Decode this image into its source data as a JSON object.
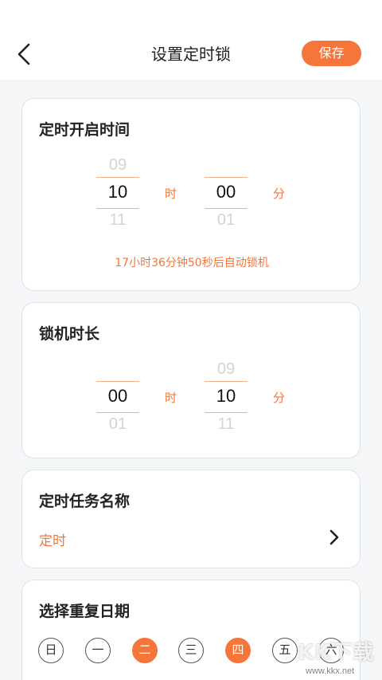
{
  "header": {
    "title": "设置定时锁",
    "save_label": "保存"
  },
  "start_time": {
    "title": "定时开启时间",
    "hour": {
      "prev": "09",
      "selected": "10",
      "next": "11"
    },
    "minute": {
      "prev": "",
      "selected": "00",
      "next": "01"
    },
    "hour_unit": "时",
    "minute_unit": "分",
    "hint": "17小时36分钟50秒后自动锁机"
  },
  "duration": {
    "title": "锁机时长",
    "hour": {
      "prev": "",
      "selected": "00",
      "next": "01"
    },
    "minute": {
      "prev": "09",
      "selected": "10",
      "next": "11"
    },
    "hour_unit": "时",
    "minute_unit": "分"
  },
  "task_name": {
    "title": "定时任务名称",
    "value": "定时"
  },
  "repeat": {
    "title": "选择重复日期",
    "days": [
      {
        "label": "日",
        "active": false
      },
      {
        "label": "一",
        "active": false
      },
      {
        "label": "二",
        "active": true
      },
      {
        "label": "三",
        "active": false
      },
      {
        "label": "四",
        "active": true
      },
      {
        "label": "五",
        "active": false
      },
      {
        "label": "六",
        "active": false
      }
    ]
  },
  "watermark": {
    "text": "KK下载",
    "url": "www.kkx.net"
  },
  "colors": {
    "accent": "#f5753a",
    "background": "#f5f6f8",
    "card_border": "#dfe3ec"
  }
}
